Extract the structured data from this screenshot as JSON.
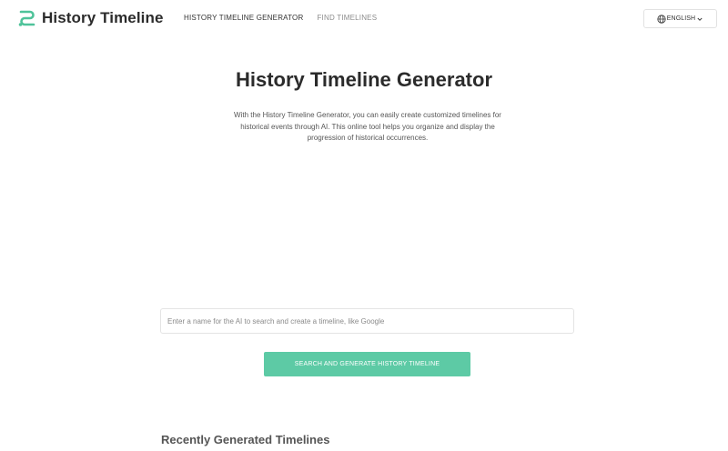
{
  "brand": {
    "name": "History Timeline",
    "accent_color": "#4fc39a"
  },
  "nav": {
    "items": [
      {
        "label": "HISTORY TIMELINE GENERATOR",
        "active": true
      },
      {
        "label": "FIND TIMELINES",
        "active": false
      }
    ]
  },
  "language": {
    "label": "ENGLISH",
    "icon": "globe-icon",
    "dropdown_icon": "chevron-down-icon"
  },
  "hero": {
    "title": "History Timeline Generator",
    "description": "With the History Timeline Generator, you can easily create customized timelines for historical events through AI. This online tool helps you organize and display the progression of historical occurrences."
  },
  "search": {
    "placeholder": "Enter a name for the AI to search and create a timeline, like Google",
    "value": ""
  },
  "generate_button": {
    "label": "SEARCH AND GENERATE HISTORY TIMELINE",
    "color": "#5dcaa5"
  },
  "recent": {
    "title": "Recently Generated Timelines"
  }
}
